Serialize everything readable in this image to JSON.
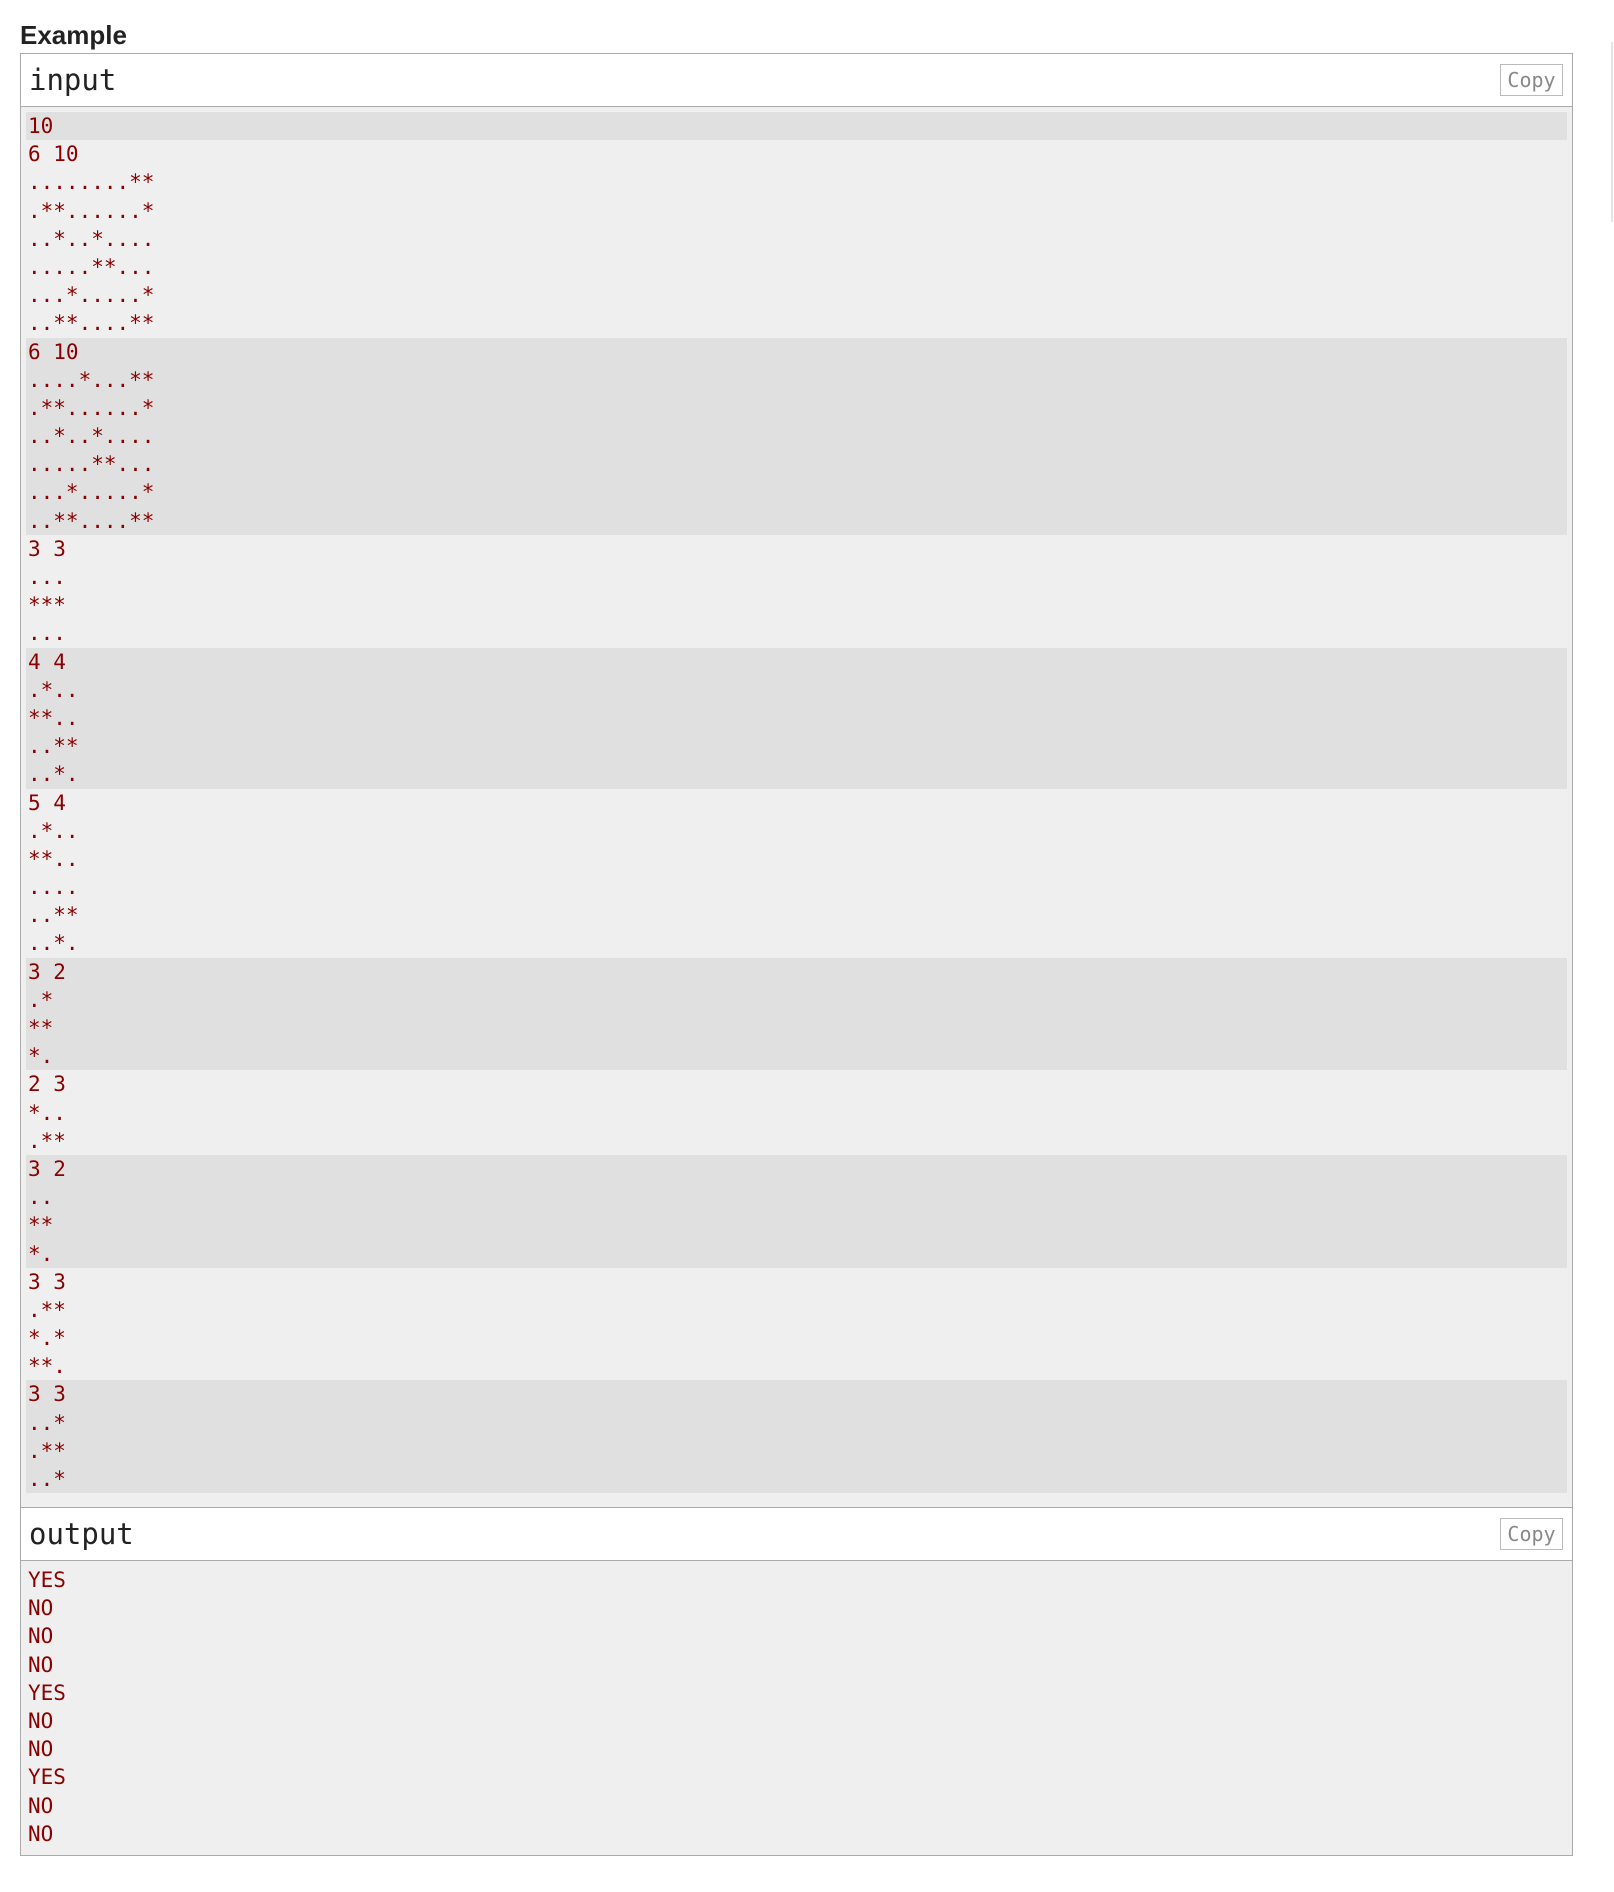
{
  "section_title": "Example",
  "input": {
    "title": "input",
    "copy_label": "Copy",
    "groups": [
      {
        "shade": "dark",
        "lines": [
          "10"
        ]
      },
      {
        "shade": "light",
        "lines": [
          "6 10",
          "........**",
          ".**......*",
          "..*..*....",
          ".....**...",
          "...*.....*",
          "..**....**"
        ]
      },
      {
        "shade": "dark",
        "lines": [
          "6 10",
          "....*...**",
          ".**......*",
          "..*..*....",
          ".....**...",
          "...*.....*",
          "..**....**"
        ]
      },
      {
        "shade": "light",
        "lines": [
          "3 3",
          "...",
          "***",
          "..."
        ]
      },
      {
        "shade": "dark",
        "lines": [
          "4 4",
          ".*..",
          "**..",
          "..**",
          "..*."
        ]
      },
      {
        "shade": "light",
        "lines": [
          "5 4",
          ".*..",
          "**..",
          "....",
          "..**",
          "..*."
        ]
      },
      {
        "shade": "dark",
        "lines": [
          "3 2",
          ".*",
          "**",
          "*."
        ]
      },
      {
        "shade": "light",
        "lines": [
          "2 3",
          "*..",
          ".**"
        ]
      },
      {
        "shade": "dark",
        "lines": [
          "3 2",
          "..",
          "**",
          "*."
        ]
      },
      {
        "shade": "light",
        "lines": [
          "3 3",
          ".**",
          "*.*",
          "**."
        ]
      },
      {
        "shade": "dark",
        "lines": [
          "3 3",
          "..*",
          ".**",
          "..*"
        ]
      }
    ]
  },
  "output": {
    "title": "output",
    "copy_label": "Copy",
    "lines": [
      "YES",
      "NO",
      "NO",
      "NO",
      "YES",
      "NO",
      "NO",
      "YES",
      "NO",
      "NO"
    ]
  }
}
